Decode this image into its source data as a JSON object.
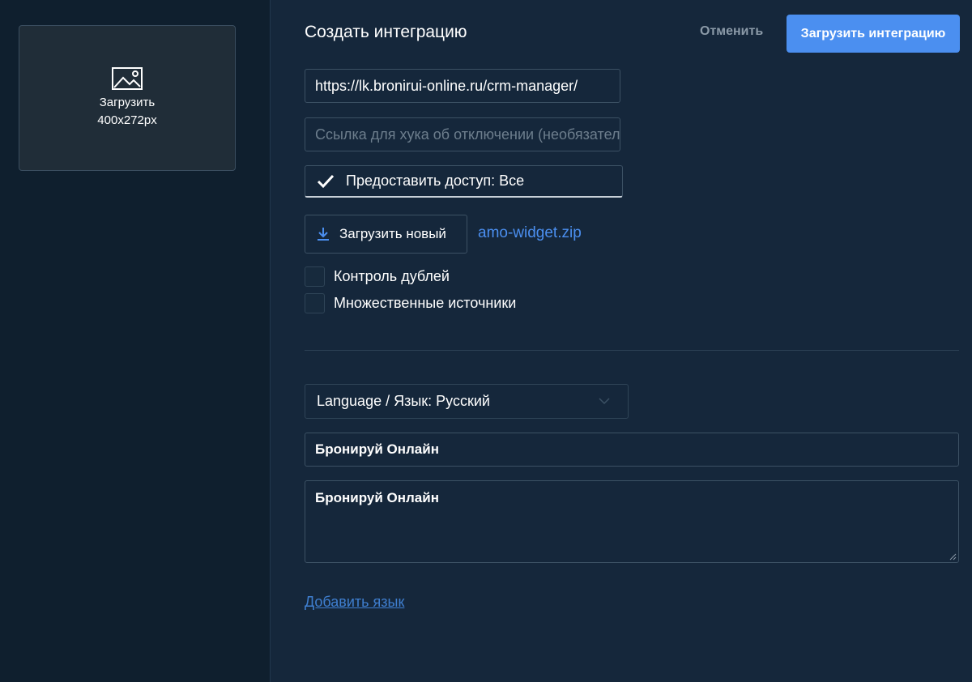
{
  "image_upload": {
    "label_line1": "Загрузить",
    "label_line2": "400x272px",
    "icon": "image-icon"
  },
  "header": {
    "title": "Создать интеграцию",
    "cancel_label": "Отменить",
    "submit_label": "Загрузить интеграцию"
  },
  "form": {
    "redirect_url_value": "https://lk.bronirui-online.ru/crm-manager/",
    "disable_hook_placeholder": "Ссылка для хука об отключении (необязательно)",
    "access_checkbox_label": "Предоставить доступ: Все",
    "access_checked": true,
    "upload_new_label": "Загрузить новый",
    "archive_file_name": "amo-widget.zip",
    "duplicates_control_label": "Контроль дублей",
    "multiple_sources_label": "Множественные источники"
  },
  "localization": {
    "language_select_label": "Language / Язык: Русский",
    "name_value": "Бронируй Онлайн",
    "description_value": "Бронируй Онлайн",
    "add_language_label": "Добавить язык"
  },
  "colors": {
    "accent": "#4b8ff0",
    "background": "#15273b",
    "sidebar": "#0f1f2e"
  }
}
